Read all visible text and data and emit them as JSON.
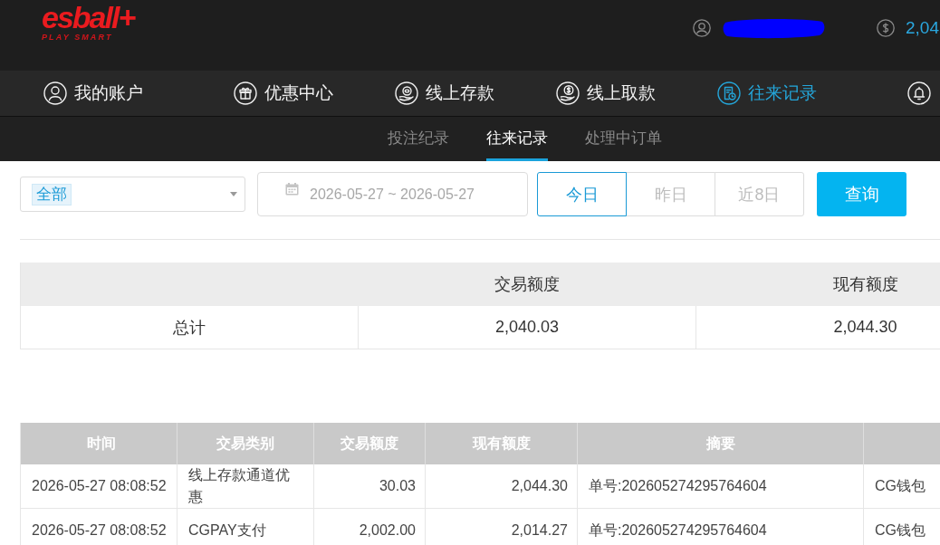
{
  "header": {
    "logo": {
      "wordmark": "esball+",
      "tagline": "PLAY SMART"
    },
    "balance": "2,04"
  },
  "nav": [
    {
      "kind": "account",
      "label": "我的账户",
      "selected": false
    },
    {
      "kind": "promo",
      "label": "优惠中心",
      "selected": false
    },
    {
      "kind": "deposit",
      "label": "线上存款",
      "selected": false
    },
    {
      "kind": "withdraw",
      "label": "线上取款",
      "selected": false
    },
    {
      "kind": "records",
      "label": "往来记录",
      "selected": true
    },
    {
      "kind": "notice",
      "selected": false
    }
  ],
  "subtabs": [
    {
      "label": "投注纪录",
      "selected": false
    },
    {
      "label": "往来记录",
      "selected": true
    },
    {
      "label": "处理中订单",
      "selected": false
    }
  ],
  "filter": {
    "type_select": {
      "tags": [
        "全部"
      ]
    },
    "date_range": {
      "value": "2026-05-27 ~ 2026-05-27"
    },
    "quick_ranges": [
      {
        "label": "今日",
        "selected": true
      },
      {
        "label": "昨日",
        "selected": false
      },
      {
        "label": "近8日",
        "selected": false
      }
    ],
    "search_button": "查询"
  },
  "summary": {
    "columns": [
      "交易额度",
      "现有额度"
    ],
    "rows": [
      {
        "label": "总计",
        "values": [
          "2,040.03",
          "2,044.30"
        ]
      }
    ]
  },
  "transactions": {
    "columns": [
      {
        "label": "时间",
        "kind": "text"
      },
      {
        "label": "交易类别",
        "kind": "text"
      },
      {
        "label": "交易额度",
        "kind": "amount"
      },
      {
        "label": "现有额度",
        "kind": "amount"
      },
      {
        "label": "摘要",
        "kind": "text"
      },
      {
        "kind": "text"
      }
    ],
    "rows": [
      {
        "cells": [
          "2026-05-27 08:08:52",
          "线上存款通道优惠",
          "30.03",
          "2,044.30",
          "单号:202605274295764604",
          "CG钱包"
        ]
      },
      {
        "cells": [
          "2026-05-27 08:08:52",
          "CGPAY支付",
          "2,002.00",
          "2,014.27",
          "单号:202605274295764604",
          "CG钱包"
        ]
      }
    ]
  }
}
